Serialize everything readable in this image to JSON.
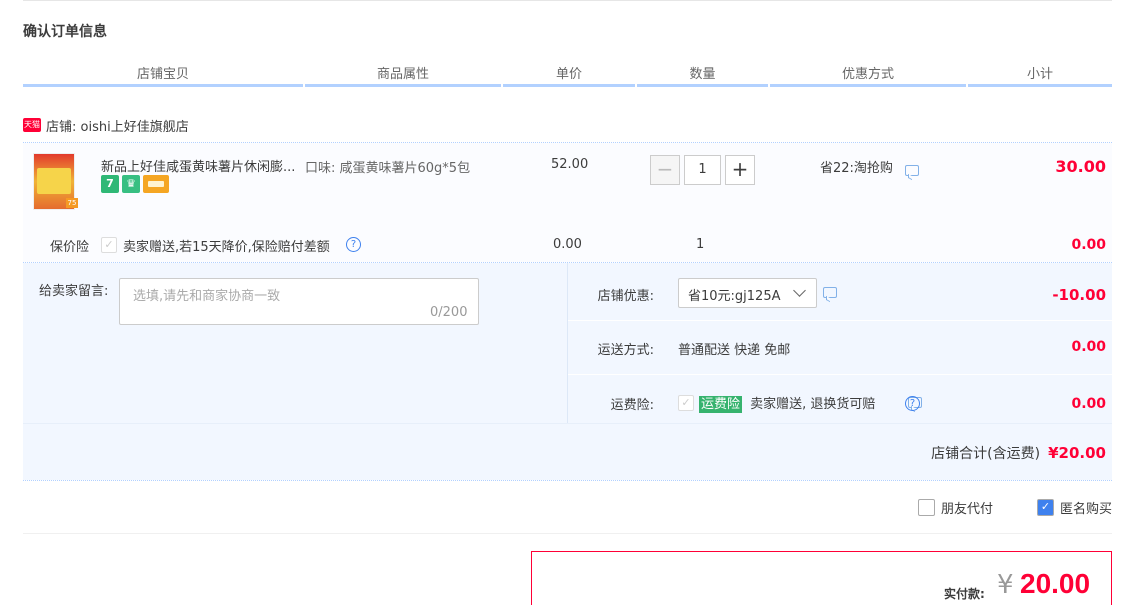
{
  "section_title": "确认订单信息",
  "columns": [
    "店铺宝贝",
    "商品属性",
    "单价",
    "数量",
    "优惠方式",
    "小计"
  ],
  "shop": {
    "badge": "天猫",
    "label": "店铺: oishi上好佳旗舰店"
  },
  "item": {
    "title": "新品上好佳咸蛋黄味薯片休闲膨...",
    "thumb_badge": "75",
    "tags": [
      {
        "text": "7",
        "color": "#2fb876"
      },
      {
        "text": "♛",
        "color": "#37bf82"
      }
    ],
    "sku": "口味: 咸蛋黄味薯片60g*5包",
    "unit_price": "52.00",
    "quantity": "1",
    "promo": "省22:淘抢购",
    "subtotal": "30.00"
  },
  "insurance": {
    "label": "保价险",
    "text": "卖家赠送,若15天降价,保险赔付差额",
    "price": "0.00",
    "qty": "1",
    "subtotal": "0.00"
  },
  "message": {
    "label": "给卖家留言:",
    "placeholder": "选填,请先和商家协商一致",
    "count": "0/200"
  },
  "shop_discount": {
    "label": "店铺优惠:",
    "selected": "省10元:gj125A",
    "value": "-10.00"
  },
  "shipping": {
    "label": "运送方式:",
    "value_text": "普通配送 快递 免邮",
    "value": "0.00"
  },
  "freight_ins": {
    "label": "运费险:",
    "badge": "运费险",
    "text": "卖家赠送, 退换货可赔",
    "value": "0.00"
  },
  "store_total": {
    "label": "店铺合计(含运费)",
    "value": "¥20.00"
  },
  "options": {
    "friend_pay": "朋友代付",
    "anonymous": "匿名购买"
  },
  "payment": {
    "label": "实付款:",
    "currency": "¥",
    "amount": "20.00"
  }
}
